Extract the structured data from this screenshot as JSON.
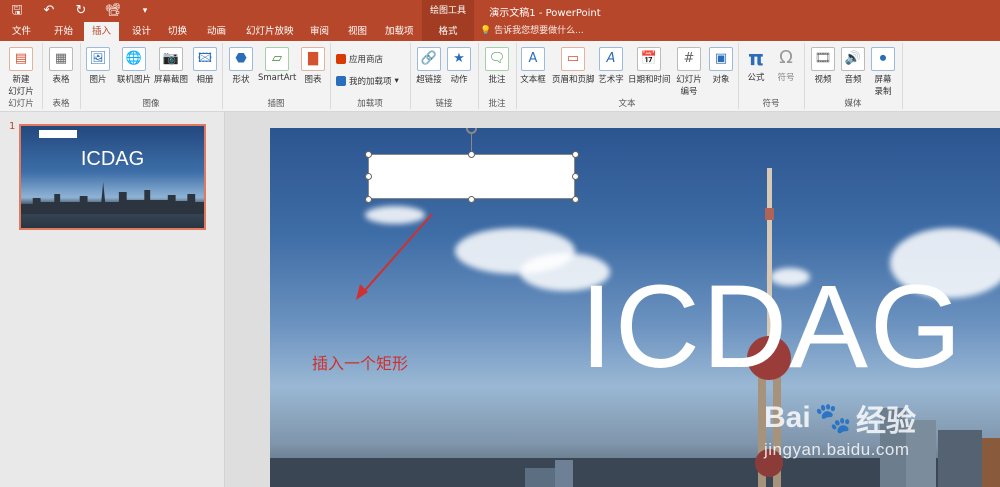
{
  "quick_access": {
    "save_icon": "save-icon",
    "undo_icon": "undo-icon",
    "redo_icon": "redo-icon",
    "slideshow_icon": "presenter-icon",
    "customize_icon": "customize-qat-icon"
  },
  "window": {
    "title": "演示文稿1 - PowerPoint",
    "context_tool": "绘图工具"
  },
  "tabs": [
    "文件",
    "开始",
    "插入",
    "设计",
    "切换",
    "动画",
    "幻灯片放映",
    "审阅",
    "视图",
    "加载项",
    "格式"
  ],
  "active_tab": "插入",
  "tell_me": "告诉我您想要做什么...",
  "ribbon": {
    "slides": {
      "label": "幻灯片",
      "new_slide": "新建",
      "new_slide_2": "幻灯片"
    },
    "tables": {
      "label": "表格",
      "table": "表格"
    },
    "images": {
      "label": "图像",
      "picture": "图片",
      "online_picture": "联机图片",
      "screenshot": "屏幕截图",
      "album": "相册"
    },
    "illustrations": {
      "label": "插图",
      "shapes": "形状",
      "smartart": "SmartArt",
      "chart": "图表"
    },
    "addins": {
      "label": "加载项",
      "store": "应用商店",
      "my_addins": "我的加载项"
    },
    "links": {
      "label": "链接",
      "hyperlink": "超链接",
      "action": "动作"
    },
    "comments": {
      "label": "批注",
      "comment": "批注"
    },
    "text": {
      "label": "文本",
      "textbox": "文本框",
      "header_footer": "页眉和页脚",
      "wordart": "艺术字",
      "datetime": "日期和时间",
      "slide_number": "幻灯片",
      "slide_number_2": "编号",
      "object": "对象"
    },
    "symbols": {
      "label": "符号",
      "equation": "公式",
      "symbol": "符号"
    },
    "media": {
      "label": "媒体",
      "video": "视频",
      "audio": "音频",
      "screen_rec": "屏幕",
      "screen_rec_2": "录制"
    }
  },
  "thumbnails": {
    "slide_number": "1",
    "title": "ICDAG"
  },
  "slide": {
    "title": "ICDAG",
    "annotation": "插入一个矩形"
  },
  "watermark": {
    "brand": "Bai",
    "brand_suffix": "经验",
    "url": "jingyan.baidu.com"
  },
  "colors": {
    "accent": "#b7472a",
    "annotation": "#d0302f",
    "thumb_border": "#e07a5f"
  }
}
